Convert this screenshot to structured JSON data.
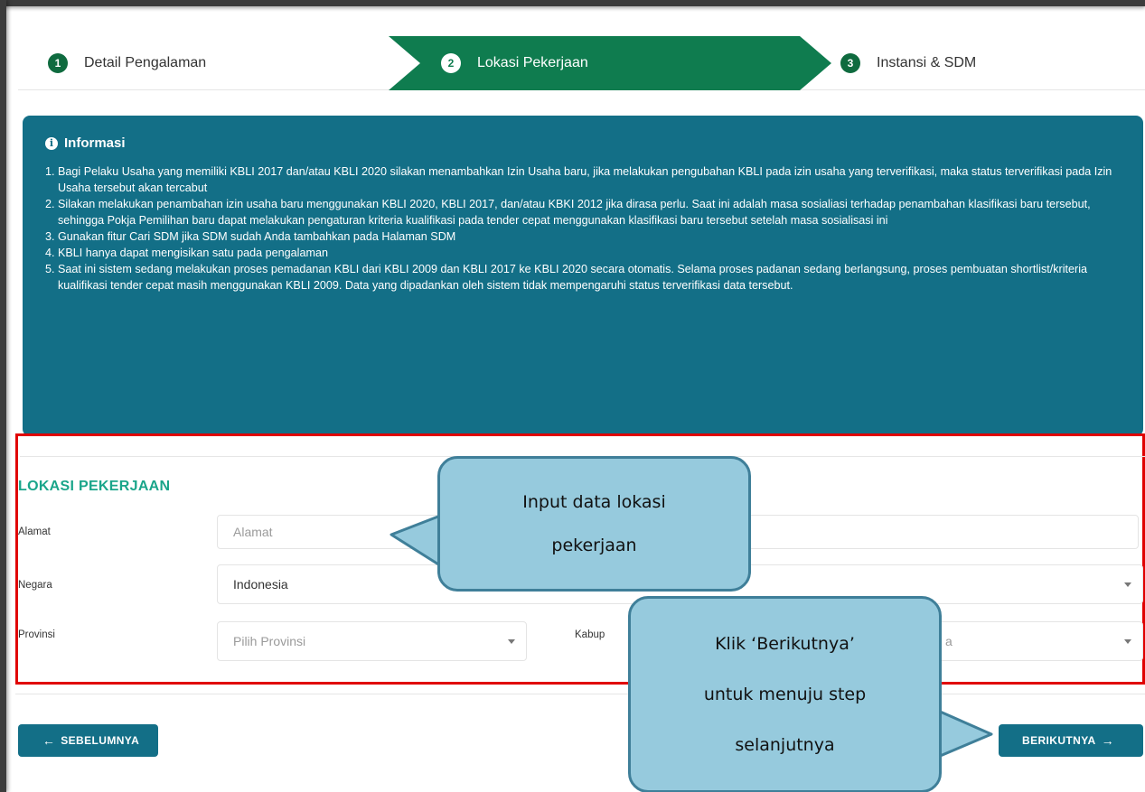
{
  "stepper": {
    "steps": [
      {
        "num": "1",
        "label": "Detail Pengalaman"
      },
      {
        "num": "2",
        "label": "Lokasi Pekerjaan"
      },
      {
        "num": "3",
        "label": "Instansi & SDM"
      }
    ],
    "active_step": 2
  },
  "info": {
    "title": "Informasi",
    "icon": "info-circle-icon",
    "items": [
      "1. Bagi Pelaku Usaha yang memiliki KBLI 2017 dan/atau KBLI 2020 silakan menambahkan Izin Usaha baru, jika melakukan pengubahan KBLI pada izin usaha yang terverifikasi, maka status terverifikasi pada Izin Usaha tersebut akan tercabut",
      "2. Silakan melakukan penambahan izin usaha baru menggunakan KBLI 2020, KBLI 2017, dan/atau KBKI 2012 jika dirasa perlu. Saat ini adalah masa sosialiasi terhadap penambahan klasifikasi baru tersebut, sehingga Pokja Pemilihan baru dapat melakukan pengaturan kriteria kualifikasi pada tender cepat menggunakan klasifikasi baru tersebut setelah masa sosialisasi ini",
      "3. Gunakan fitur Cari SDM jika SDM sudah Anda tambahkan pada Halaman SDM",
      "4. KBLI hanya dapat mengisikan satu pada pengalaman",
      "5. Saat ini sistem sedang melakukan proses pemadanan KBLI dari KBLI 2009 dan KBLI 2017 ke KBLI 2020 secara otomatis. Selama proses padanan sedang berlangsung, proses pembuatan shortlist/kriteria kualifikasi tender cepat masih menggunakan KBLI 2009. Data yang dipadankan oleh sistem tidak mempengaruhi status terverifikasi data tersebut."
    ]
  },
  "form": {
    "section_title": "LOKASI PEKERJAAN",
    "alamat_label": "Alamat",
    "alamat_placeholder": "Alamat",
    "negara_label": "Negara",
    "negara_value": "Indonesia",
    "provinsi_label": "Provinsi",
    "provinsi_placeholder": "Pilih Provinsi",
    "kabupaten_label_visible": "Kabup",
    "kabupaten_value_visible": "a"
  },
  "buttons": {
    "prev_label": "SEBELUMNYA",
    "next_label": "BERIKUTNYA"
  },
  "callouts": {
    "input": [
      "Input data lokasi",
      "pekerjaan"
    ],
    "next": [
      "Klik ‘Berikutnya’",
      "untuk menuju step",
      "selanjutnya"
    ]
  },
  "colors": {
    "active_step": "#0f7c4f",
    "info_bg": "#136f87",
    "section_title": "#1aa58a",
    "highlight_border": "#e00000",
    "callout_fill": "#96cadd",
    "callout_border": "#3f7f99"
  }
}
